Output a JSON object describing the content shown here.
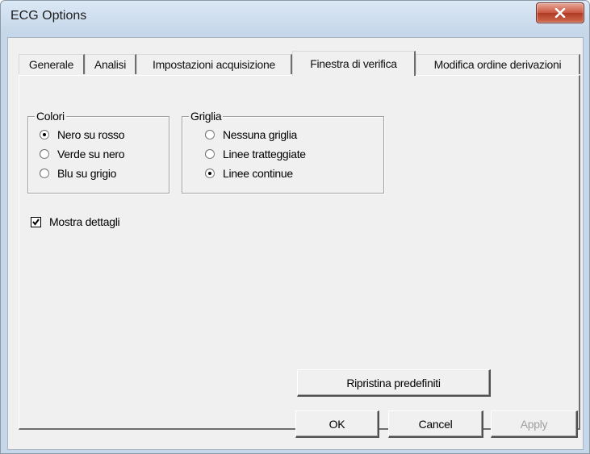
{
  "window": {
    "title": "ECG Options"
  },
  "tabs": [
    {
      "label": "Generale",
      "active": false
    },
    {
      "label": "Analisi",
      "active": false
    },
    {
      "label": "Impostazioni acquisizione",
      "active": false
    },
    {
      "label": "Finestra di verifica",
      "active": true
    },
    {
      "label": "Modifica ordine derivazioni",
      "active": false
    }
  ],
  "colori": {
    "legend": "Colori",
    "options": [
      "Nero su rosso",
      "Verde su nero",
      "Blu su grigio"
    ],
    "selected": "Nero su rosso"
  },
  "griglia": {
    "legend": "Griglia",
    "options": [
      "Nessuna griglia",
      "Linee tratteggiate",
      "Linee continue"
    ],
    "selected": "Linee continue"
  },
  "details": {
    "label": "Mostra dettagli",
    "checked": true
  },
  "buttons": {
    "restore": "Ripristina predefiniti",
    "ok": "OK",
    "cancel": "Cancel",
    "apply": "Apply"
  }
}
